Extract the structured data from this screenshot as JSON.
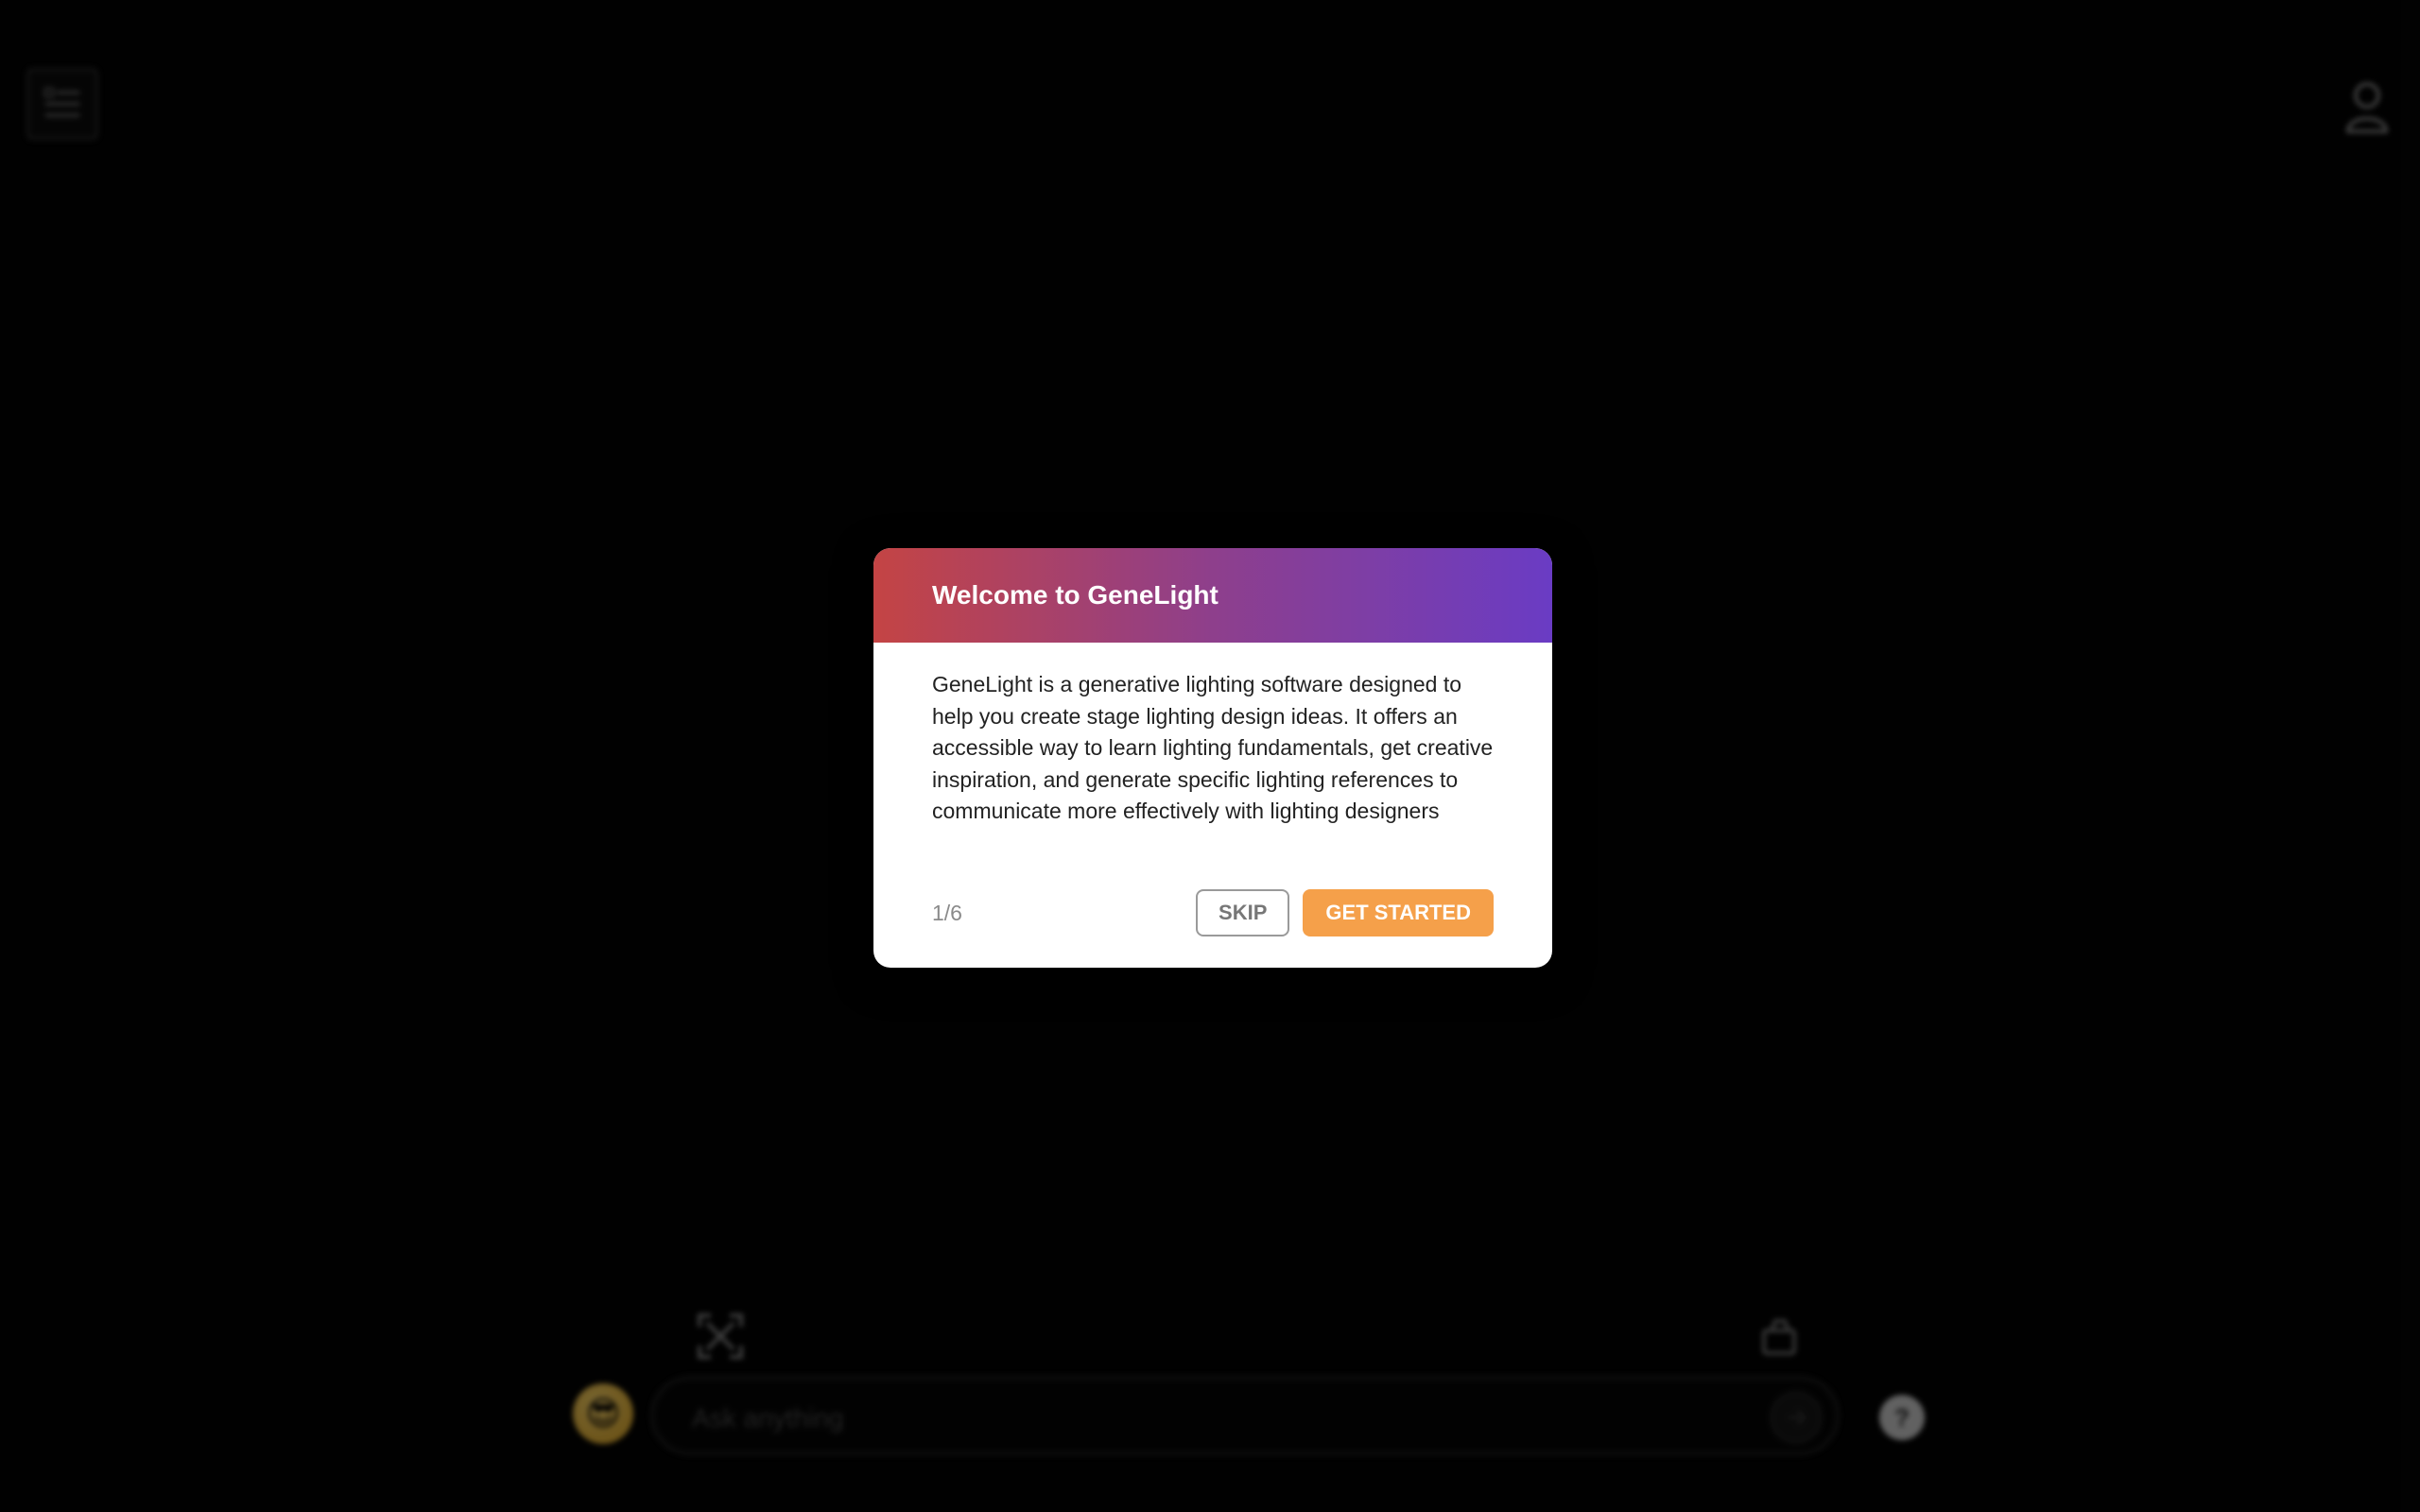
{
  "input": {
    "placeholder": "Ask anything"
  },
  "icons": {
    "menu": "menu-icon",
    "user": "user-icon",
    "expand": "expand-icon",
    "clear": "clear-chat-icon",
    "avatar": "sunglasses-emoji-icon",
    "send": "send-icon",
    "help": "help-icon"
  },
  "help": {
    "label": "?"
  },
  "avatar": {
    "emoji": "😎"
  },
  "modal": {
    "title": "Welcome to GeneLight",
    "body": "GeneLight is a generative lighting software designed to help you create stage lighting design ideas. It offers an accessible way to learn lighting fundamentals, get creative inspiration, and generate specific lighting references to communicate more effectively with lighting designers",
    "step": "1/6",
    "skip_label": "SKIP",
    "start_label": "GET STARTED"
  },
  "colors": {
    "header_gradient_start": "#c44444",
    "header_gradient_end": "#6a3cc4",
    "primary_button": "#f5a04a",
    "background": "#000000"
  }
}
